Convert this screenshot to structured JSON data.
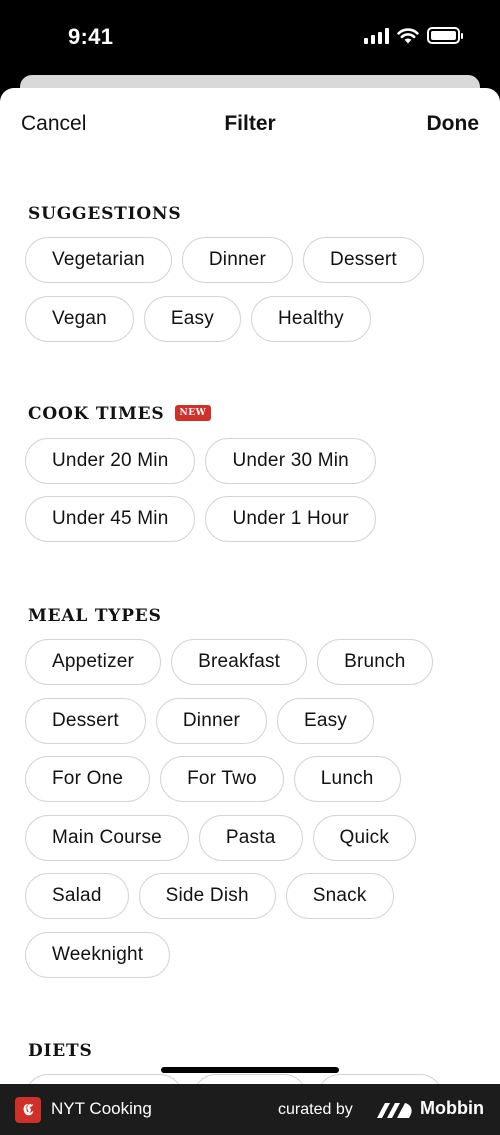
{
  "status_bar": {
    "time": "9:41"
  },
  "nav": {
    "cancel": "Cancel",
    "title": "Filter",
    "done": "Done"
  },
  "sections": {
    "suggestions": {
      "title": "SUGGESTIONS",
      "rows": [
        [
          "Vegetarian",
          "Dinner",
          "Dessert"
        ],
        [
          "Vegan",
          "Easy",
          "Healthy"
        ]
      ]
    },
    "cook_times": {
      "title": "COOK TIMES",
      "badge": "NEW",
      "rows": [
        [
          "Under 20 Min",
          "Under 30 Min"
        ],
        [
          "Under 45 Min",
          "Under 1 Hour"
        ]
      ]
    },
    "meal_types": {
      "title": "MEAL TYPES",
      "rows": [
        [
          "Appetizer",
          "Breakfast",
          "Brunch"
        ],
        [
          "Dessert",
          "Dinner",
          "Easy"
        ],
        [
          "For One",
          "For Two",
          "Lunch"
        ],
        [
          "Main Course",
          "Pasta",
          "Quick"
        ],
        [
          "Salad",
          "Side Dish",
          "Snack"
        ],
        [
          "Weeknight"
        ]
      ]
    },
    "diets": {
      "title": "DIETS"
    }
  },
  "footer": {
    "app_name": "NYT Cooking",
    "logo_glyph": "𝕮",
    "curated_by": "curated by",
    "brand": "Mobbin"
  }
}
